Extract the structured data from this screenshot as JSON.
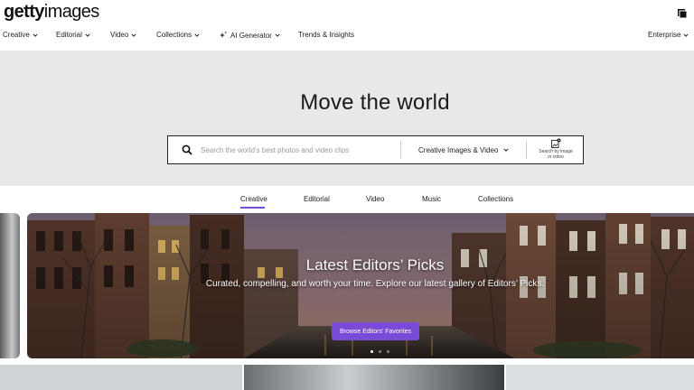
{
  "brand": {
    "logo_bold": "getty",
    "logo_light": "images"
  },
  "header_icons": {
    "corner": "cart-icon"
  },
  "nav": {
    "items": [
      {
        "label": "Creative",
        "dropdown": true
      },
      {
        "label": "Editorial",
        "dropdown": true
      },
      {
        "label": "Video",
        "dropdown": true
      },
      {
        "label": "Collections",
        "dropdown": true
      },
      {
        "label": "AI Generator",
        "dropdown": true,
        "icon": "sparkle-icon"
      },
      {
        "label": "Trends & Insights",
        "dropdown": false
      }
    ],
    "right": {
      "label": "Enterprise",
      "dropdown": true
    }
  },
  "hero": {
    "title": "Move the world",
    "search": {
      "placeholder": "Search the world's best photos and video clips",
      "type_label": "Creative Images & Video",
      "image_search_label": "Search by image or video"
    }
  },
  "tabs": {
    "items": [
      "Creative",
      "Editorial",
      "Video",
      "Music",
      "Collections"
    ],
    "active": "Creative"
  },
  "banner": {
    "title": "Latest Editors’ Picks",
    "subtitle": "Curated, compelling, and worth your time. Explore our latest gallery of Editors’ Picks.",
    "button_label": "Browse Editors’ Favorites",
    "slide_count": 3,
    "active_slide": 1
  },
  "colors": {
    "accent": "#7a4bd6",
    "hero_bg": "#e8e8e8",
    "text": "#111111"
  }
}
